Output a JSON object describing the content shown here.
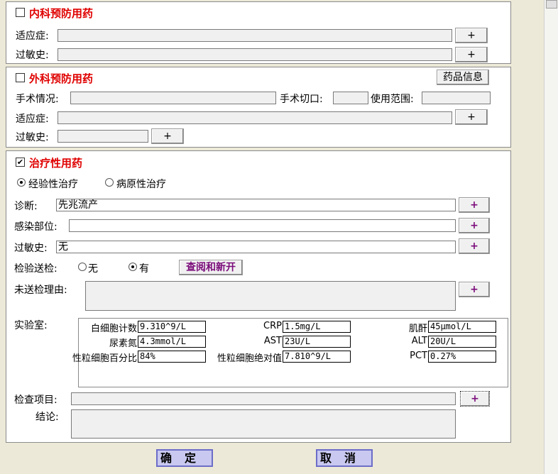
{
  "internal": {
    "title": "内科预防用药",
    "indication_label": "适应症:",
    "allergy_label": "过敏史:",
    "add_label": "+"
  },
  "surgical": {
    "title": "外科预防用药",
    "drug_info_label": "药品信息",
    "surgery_label": "手术情况:",
    "incision_label": "手术切口:",
    "scope_label": "使用范围:",
    "indication_label": "适应症:",
    "allergy_label": "过敏史:",
    "add_label": "+"
  },
  "therapeutic": {
    "checkmark": "✔",
    "title": "治疗性用药",
    "empirical_label": "经验性治疗",
    "pathogen_label": "病原性治疗",
    "diagnosis_label": "诊断:",
    "diagnosis_value": "先兆流产",
    "infection_site_label": "感染部位:",
    "infection_site_value": "",
    "allergy_label": "过敏史:",
    "allergy_value": "无",
    "test_label": "检验送检:",
    "test_no_label": "无",
    "test_yes_label": "有",
    "view_new_label": "查阅和新开",
    "not_sent_reason_label": "未送检理由:",
    "add_label": "+"
  },
  "lab": {
    "label": "实验室:",
    "rows": [
      [
        {
          "name": "白细胞计数",
          "value": "9.310^9/L"
        },
        {
          "name": "CRP",
          "value": "1.5mg/L"
        },
        {
          "name": "肌酐",
          "value": "45μmol/L"
        }
      ],
      [
        {
          "name": "尿素氮",
          "value": "4.3mmol/L"
        },
        {
          "name": "AST",
          "value": "23U/L"
        },
        {
          "name": "ALT",
          "value": "20U/L"
        }
      ],
      [
        {
          "name": "性粒细胞百分比",
          "value": "84%"
        },
        {
          "name": "性粒细胞绝对值",
          "value": "7.810^9/L"
        },
        {
          "name": "PCT",
          "value": "0.27%"
        }
      ]
    ]
  },
  "exam": {
    "items_label": "检查项目:",
    "conclusion_label": "结论:",
    "add_label": "+"
  },
  "footer": {
    "ok_label": "确定",
    "cancel_label": "取消"
  }
}
